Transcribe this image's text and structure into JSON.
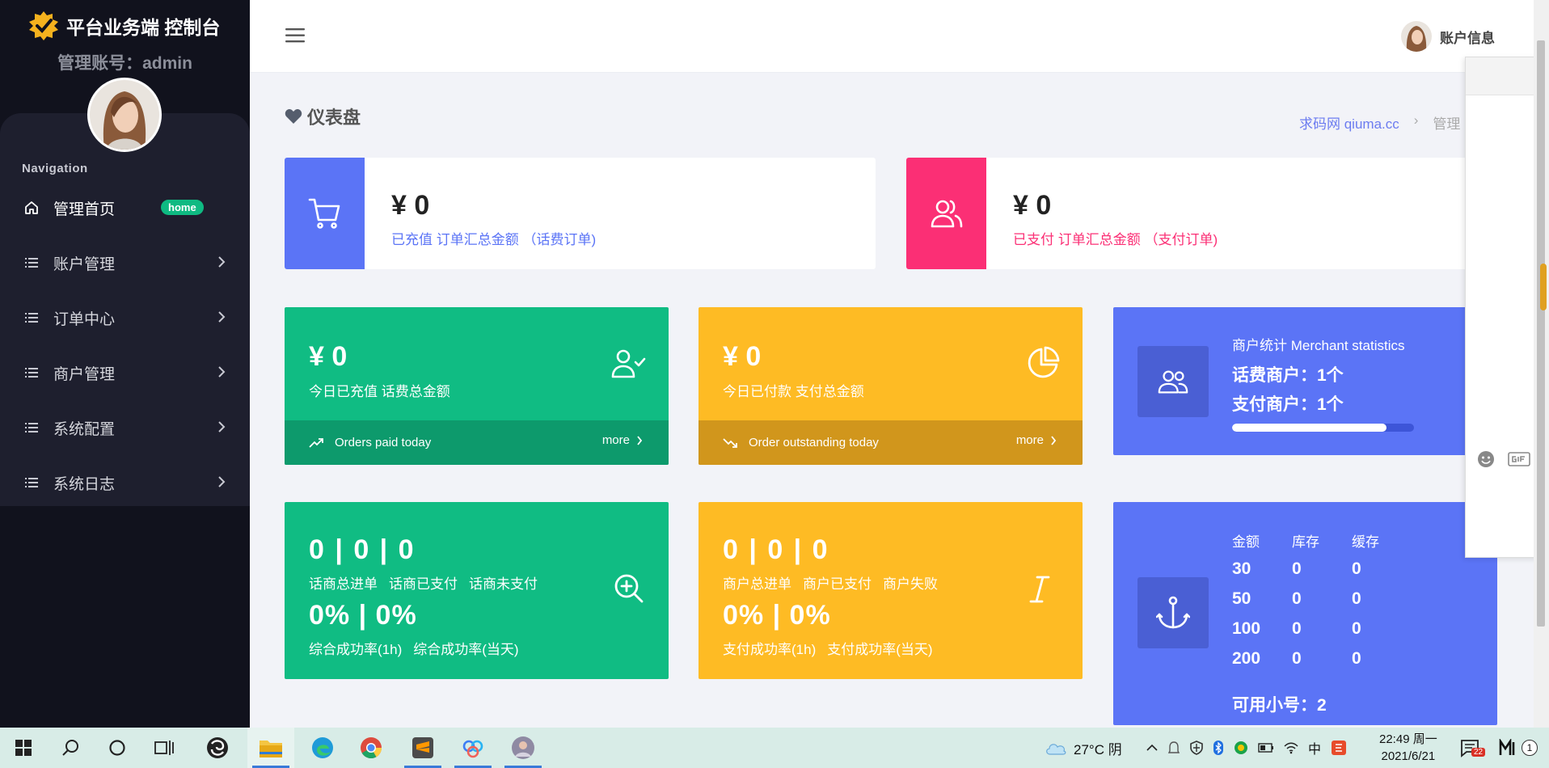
{
  "brand": {
    "title": "平台业务端 控制台",
    "admin_line": "管理账号：admin"
  },
  "sidebar": {
    "nav_title": "Navigation",
    "items": [
      {
        "label": "管理首页",
        "badge": "home",
        "icon": "home-icon"
      },
      {
        "label": "账户管理",
        "icon": "list-icon"
      },
      {
        "label": "订单中心",
        "icon": "list-icon"
      },
      {
        "label": "商户管理",
        "icon": "list-icon"
      },
      {
        "label": "系统配置",
        "icon": "list-icon"
      },
      {
        "label": "系统日志",
        "icon": "list-icon"
      }
    ]
  },
  "header": {
    "account_label": "账户信息"
  },
  "page": {
    "title": "仪表盘",
    "breadcrumb": {
      "link": "求码网 qiuma.cc",
      "sep": "›",
      "current": "管理"
    }
  },
  "summary": [
    {
      "amount": "¥ 0",
      "desc": "已充值 订单汇总金额 （话费订单)",
      "color": "#5b74f6",
      "icon": "cart-icon"
    },
    {
      "amount": "¥ 0",
      "desc": "已支付 订单汇总金额 （支付订单)",
      "color": "#fb2f75",
      "icon": "users-icon"
    }
  ],
  "today": [
    {
      "amount": "¥ 0",
      "desc": "今日已充值 话费总金额",
      "footer": "Orders paid today",
      "more": "more",
      "icon": "user-check-icon"
    },
    {
      "amount": "¥ 0",
      "desc": "今日已付款 支付总金额",
      "footer": "Order outstanding today",
      "more": "more",
      "icon": "pie-chart-icon"
    }
  ],
  "merchant": {
    "title": "商户统计 Merchant statistics",
    "phone_merchants": "话费商户：1个",
    "pay_merchants": "支付商户：1个",
    "progress": 0.85
  },
  "phone_stats": {
    "counts": "0 | 0 | 0",
    "labels": [
      "话商总进单",
      "话商已支付",
      "话商未支付"
    ],
    "rates": "0% | 0%",
    "rate_labels": [
      "综合成功率(1h)",
      "综合成功率(当天)"
    ]
  },
  "pay_stats": {
    "counts": "0 | 0 | 0",
    "labels": [
      "商户总进单",
      "商户已支付",
      "商户失败"
    ],
    "rates": "0% | 0%",
    "rate_labels": [
      "支付成功率(1h)",
      "支付成功率(当天)"
    ]
  },
  "stock": {
    "headers": [
      "金额",
      "库存",
      "缓存"
    ],
    "rows": [
      [
        "30",
        "0",
        "0"
      ],
      [
        "50",
        "0",
        "0"
      ],
      [
        "100",
        "0",
        "0"
      ],
      [
        "200",
        "0",
        "0"
      ]
    ],
    "available": "可用小号：2"
  },
  "taskbar": {
    "weather": "27°C  阴",
    "ime": "中",
    "time": "22:49 周一",
    "date": "2021/6/21",
    "notifications": "22",
    "badge": "1"
  }
}
